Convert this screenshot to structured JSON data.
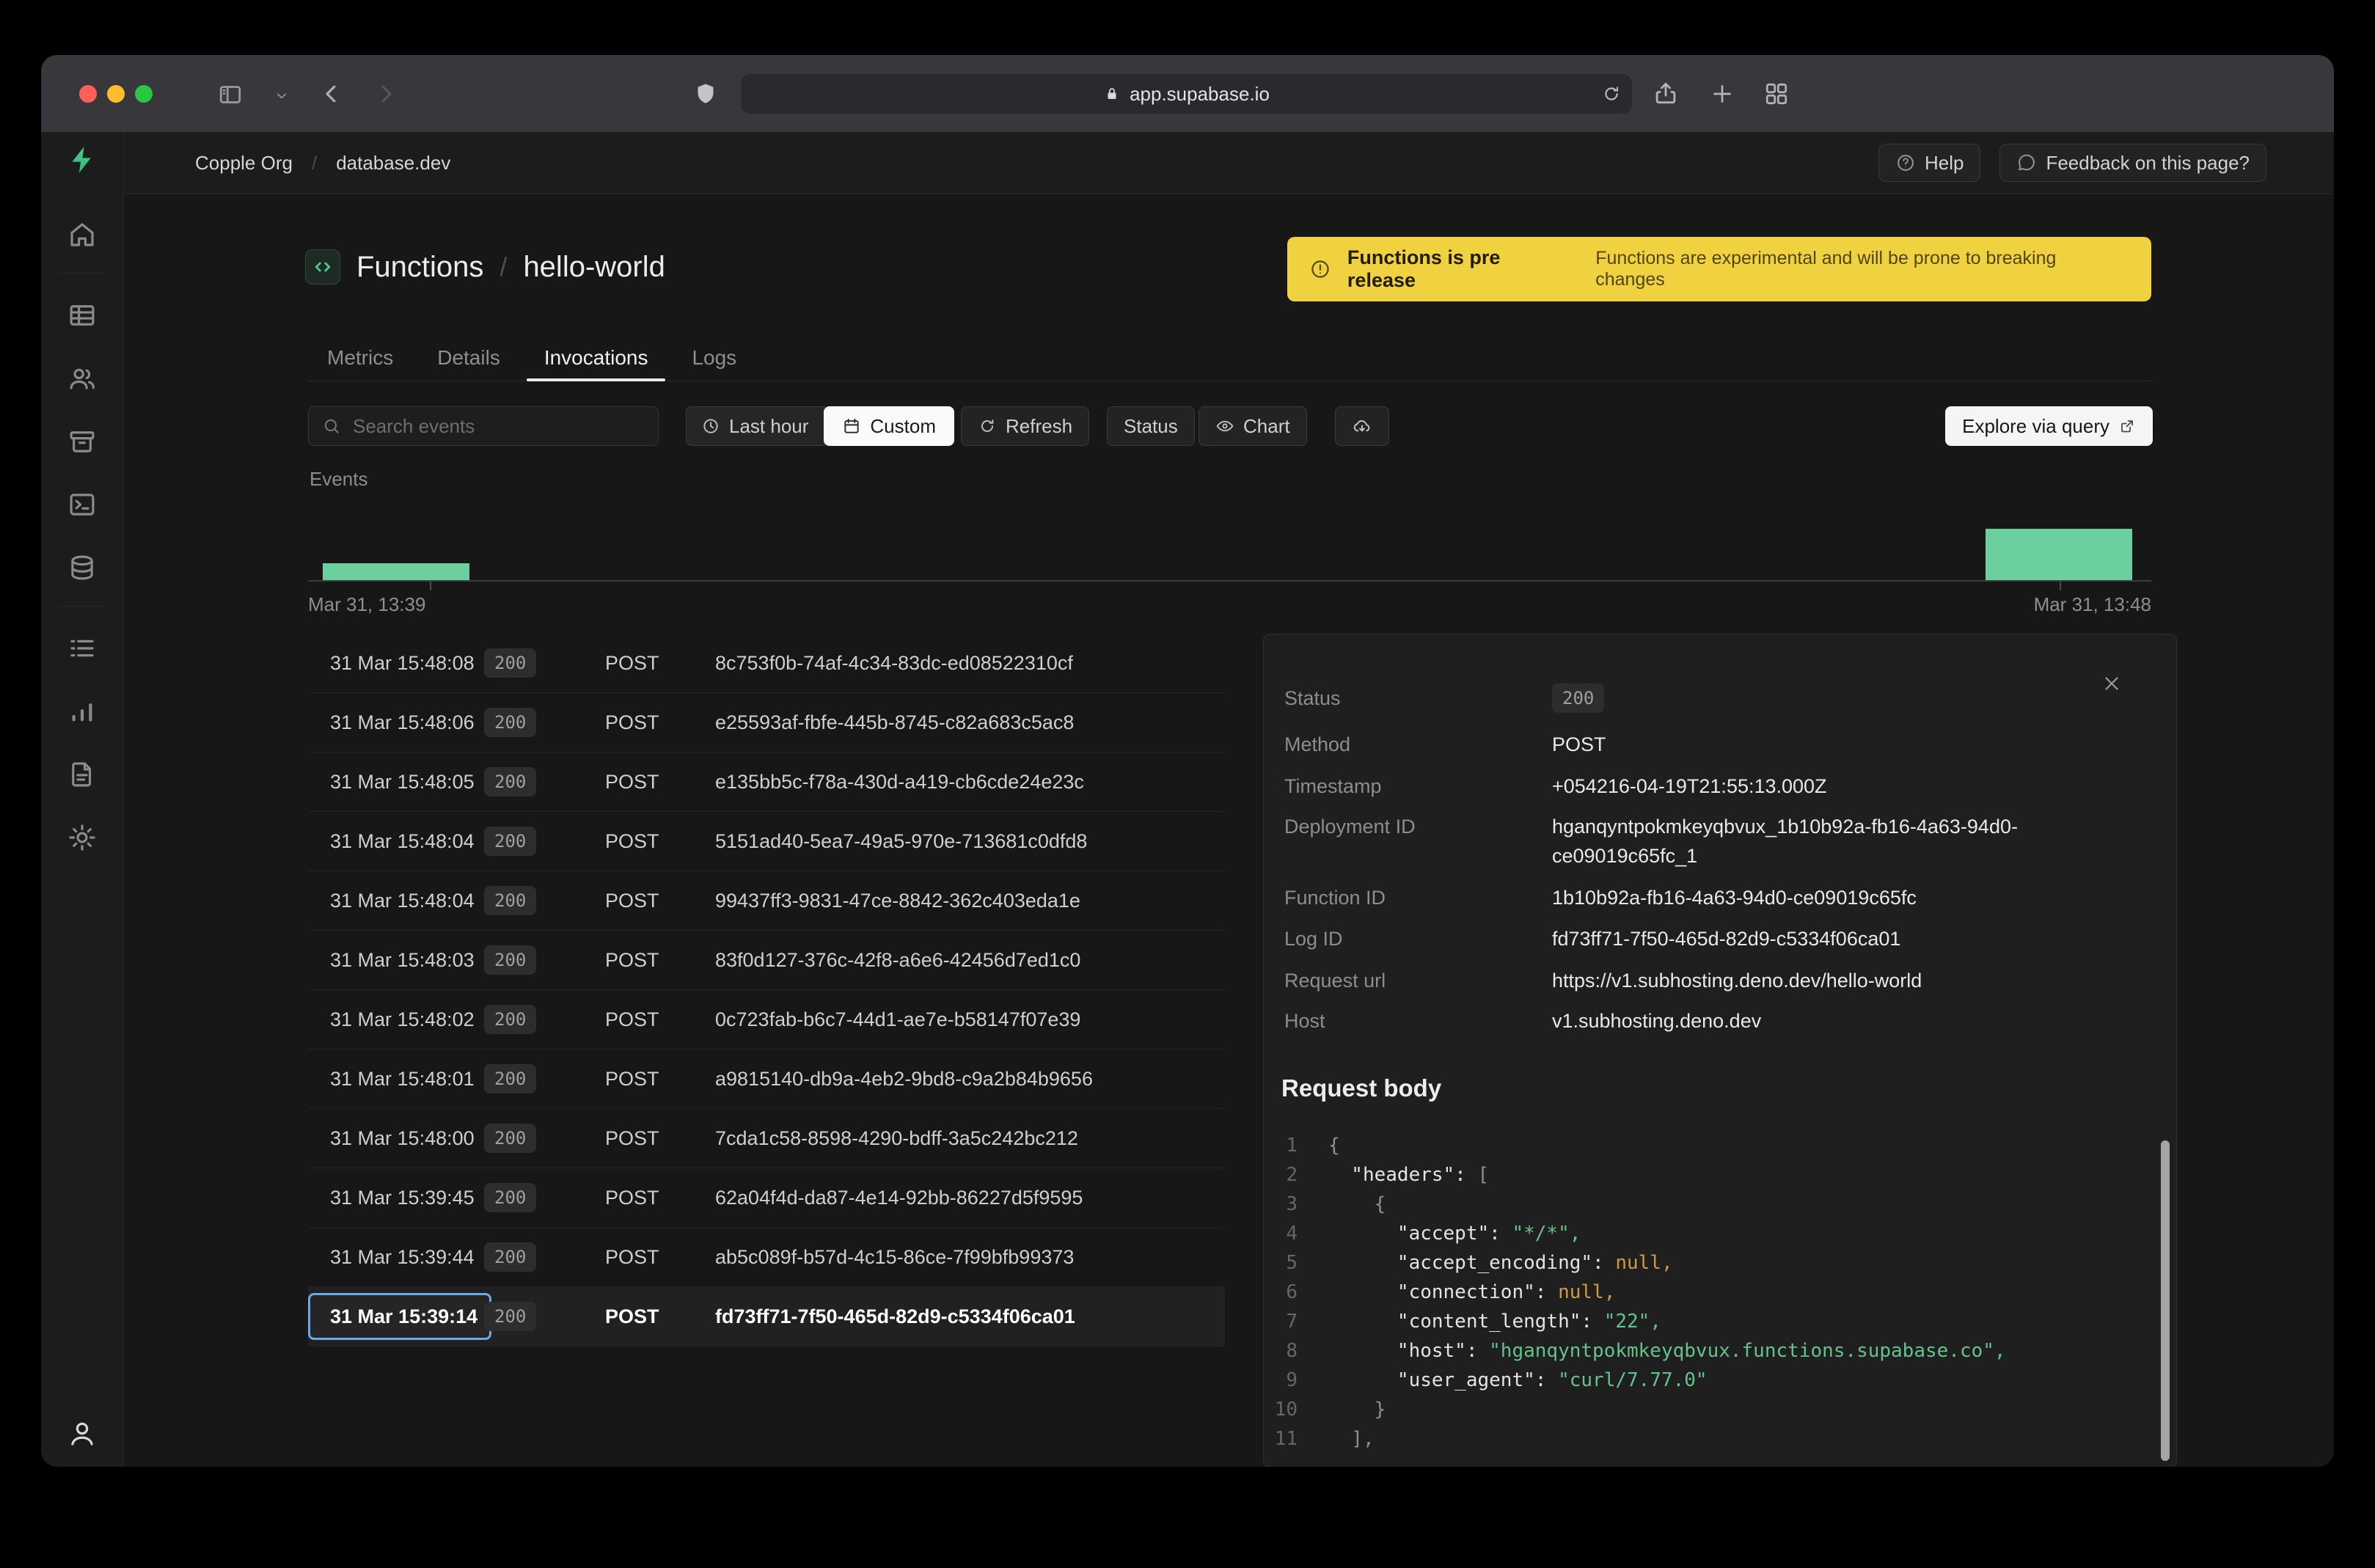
{
  "browser": {
    "address": "app.supabase.io"
  },
  "nav": {
    "breadcrumbs": [
      "Copple Org",
      "database.dev"
    ],
    "separator": "/",
    "help": "Help",
    "feedback": "Feedback on this page?"
  },
  "sidebar": {
    "items": [
      "home",
      "table-editor",
      "auth",
      "storage",
      "sql-editor",
      "database",
      "logs",
      "reports",
      "docs",
      "settings"
    ],
    "account": "account"
  },
  "page": {
    "title": "Functions",
    "separator": "/",
    "function_name": "hello-world",
    "banner": {
      "title": "Functions is pre release",
      "description": "Functions are experimental and will be prone to breaking changes"
    },
    "tabs": [
      "Metrics",
      "Details",
      "Invocations",
      "Logs"
    ],
    "active_tab": "Invocations"
  },
  "toolbar": {
    "search_placeholder": "Search events",
    "last_hour": "Last hour",
    "custom": "Custom",
    "refresh": "Refresh",
    "status": "Status",
    "chart": "Chart",
    "explore": "Explore via query"
  },
  "chart_data": {
    "type": "bar",
    "title": "Events",
    "x_ticks": [
      "Mar 31, 13:39",
      "Mar 31, 13:48"
    ],
    "bars": [
      {
        "x": "Mar 31, 13:39",
        "value": 3
      },
      {
        "x": "Mar 31, 13:48",
        "value": 9
      }
    ],
    "ymax": 9,
    "bar_color": "#6bcf9e",
    "grid": false,
    "legend": "none"
  },
  "events_table": {
    "rows": [
      {
        "time": "31 Mar 15:48:08",
        "status": "200",
        "method": "POST",
        "id": "8c753f0b-74af-4c34-83dc-ed08522310cf",
        "selected": false
      },
      {
        "time": "31 Mar 15:48:06",
        "status": "200",
        "method": "POST",
        "id": "e25593af-fbfe-445b-8745-c82a683c5ac8",
        "selected": false
      },
      {
        "time": "31 Mar 15:48:05",
        "status": "200",
        "method": "POST",
        "id": "e135bb5c-f78a-430d-a419-cb6cde24e23c",
        "selected": false
      },
      {
        "time": "31 Mar 15:48:04",
        "status": "200",
        "method": "POST",
        "id": "5151ad40-5ea7-49a5-970e-713681c0dfd8",
        "selected": false
      },
      {
        "time": "31 Mar 15:48:04",
        "status": "200",
        "method": "POST",
        "id": "99437ff3-9831-47ce-8842-362c403eda1e",
        "selected": false
      },
      {
        "time": "31 Mar 15:48:03",
        "status": "200",
        "method": "POST",
        "id": "83f0d127-376c-42f8-a6e6-42456d7ed1c0",
        "selected": false
      },
      {
        "time": "31 Mar 15:48:02",
        "status": "200",
        "method": "POST",
        "id": "0c723fab-b6c7-44d1-ae7e-b58147f07e39",
        "selected": false
      },
      {
        "time": "31 Mar 15:48:01",
        "status": "200",
        "method": "POST",
        "id": "a9815140-db9a-4eb2-9bd8-c9a2b84b9656",
        "selected": false
      },
      {
        "time": "31 Mar 15:48:00",
        "status": "200",
        "method": "POST",
        "id": "7cda1c58-8598-4290-bdff-3a5c242bc212",
        "selected": false
      },
      {
        "time": "31 Mar 15:39:45",
        "status": "200",
        "method": "POST",
        "id": "62a04f4d-da87-4e14-92bb-86227d5f9595",
        "selected": false
      },
      {
        "time": "31 Mar 15:39:44",
        "status": "200",
        "method": "POST",
        "id": "ab5c089f-b57d-4c15-86ce-7f99bfb99373",
        "selected": false
      },
      {
        "time": "31 Mar 15:39:14",
        "status": "200",
        "method": "POST",
        "id": "fd73ff71-7f50-465d-82d9-c5334f06ca01",
        "selected": true
      }
    ]
  },
  "detail": {
    "fields": [
      {
        "label": "Status",
        "value": "200"
      },
      {
        "label": "Method",
        "value": "POST"
      },
      {
        "label": "Timestamp",
        "value": "+054216-04-19T21:55:13.000Z"
      },
      {
        "label": "Deployment ID",
        "value": "hganqyntpokmkeyqbvux_1b10b92a-fb16-4a63-94d0-ce09019c65fc_1"
      },
      {
        "label": "Function ID",
        "value": "1b10b92a-fb16-4a63-94d0-ce09019c65fc"
      },
      {
        "label": "Log ID",
        "value": "fd73ff71-7f50-465d-82d9-c5334f06ca01"
      },
      {
        "label": "Request url",
        "value": "https://v1.subhosting.deno.dev/hello-world"
      },
      {
        "label": "Host",
        "value": "v1.subhosting.deno.dev"
      }
    ],
    "request_body_title": "Request body",
    "request_body_lines": [
      {
        "num": "1",
        "segs": [
          {
            "c": "br",
            "t": "{"
          }
        ]
      },
      {
        "num": "2",
        "segs": [
          {
            "c": "k",
            "t": "  \"headers\": "
          },
          {
            "c": "br",
            "t": "["
          }
        ]
      },
      {
        "num": "3",
        "segs": [
          {
            "c": "br",
            "t": "    {"
          }
        ]
      },
      {
        "num": "4",
        "segs": [
          {
            "c": "k",
            "t": "      \"accept\": "
          },
          {
            "c": "s",
            "t": "\"*/*\","
          }
        ]
      },
      {
        "num": "5",
        "segs": [
          {
            "c": "k",
            "t": "      \"accept_encoding\": "
          },
          {
            "c": "n",
            "t": "null,"
          }
        ]
      },
      {
        "num": "6",
        "segs": [
          {
            "c": "k",
            "t": "      \"connection\": "
          },
          {
            "c": "n",
            "t": "null,"
          }
        ]
      },
      {
        "num": "7",
        "segs": [
          {
            "c": "k",
            "t": "      \"content_length\": "
          },
          {
            "c": "s",
            "t": "\"22\","
          }
        ]
      },
      {
        "num": "8",
        "segs": [
          {
            "c": "k",
            "t": "      \"host\": "
          },
          {
            "c": "s",
            "t": "\"hganqyntpokmkeyqbvux.functions.supabase.co\","
          }
        ]
      },
      {
        "num": "9",
        "segs": [
          {
            "c": "k",
            "t": "      \"user_agent\": "
          },
          {
            "c": "s",
            "t": "\"curl/7.77.0\""
          }
        ]
      },
      {
        "num": "10",
        "segs": [
          {
            "c": "br",
            "t": "    }"
          }
        ]
      },
      {
        "num": "11",
        "segs": [
          {
            "c": "br",
            "t": "  ],"
          }
        ]
      }
    ]
  },
  "colors": {
    "accent_green": "#3ecf8e",
    "chart_bar": "#6bcf9e",
    "banner_yellow": "#f0d13f",
    "selection_blue": "#6ca9e8",
    "code_string": "#63c38c",
    "code_null": "#d19a3f"
  }
}
